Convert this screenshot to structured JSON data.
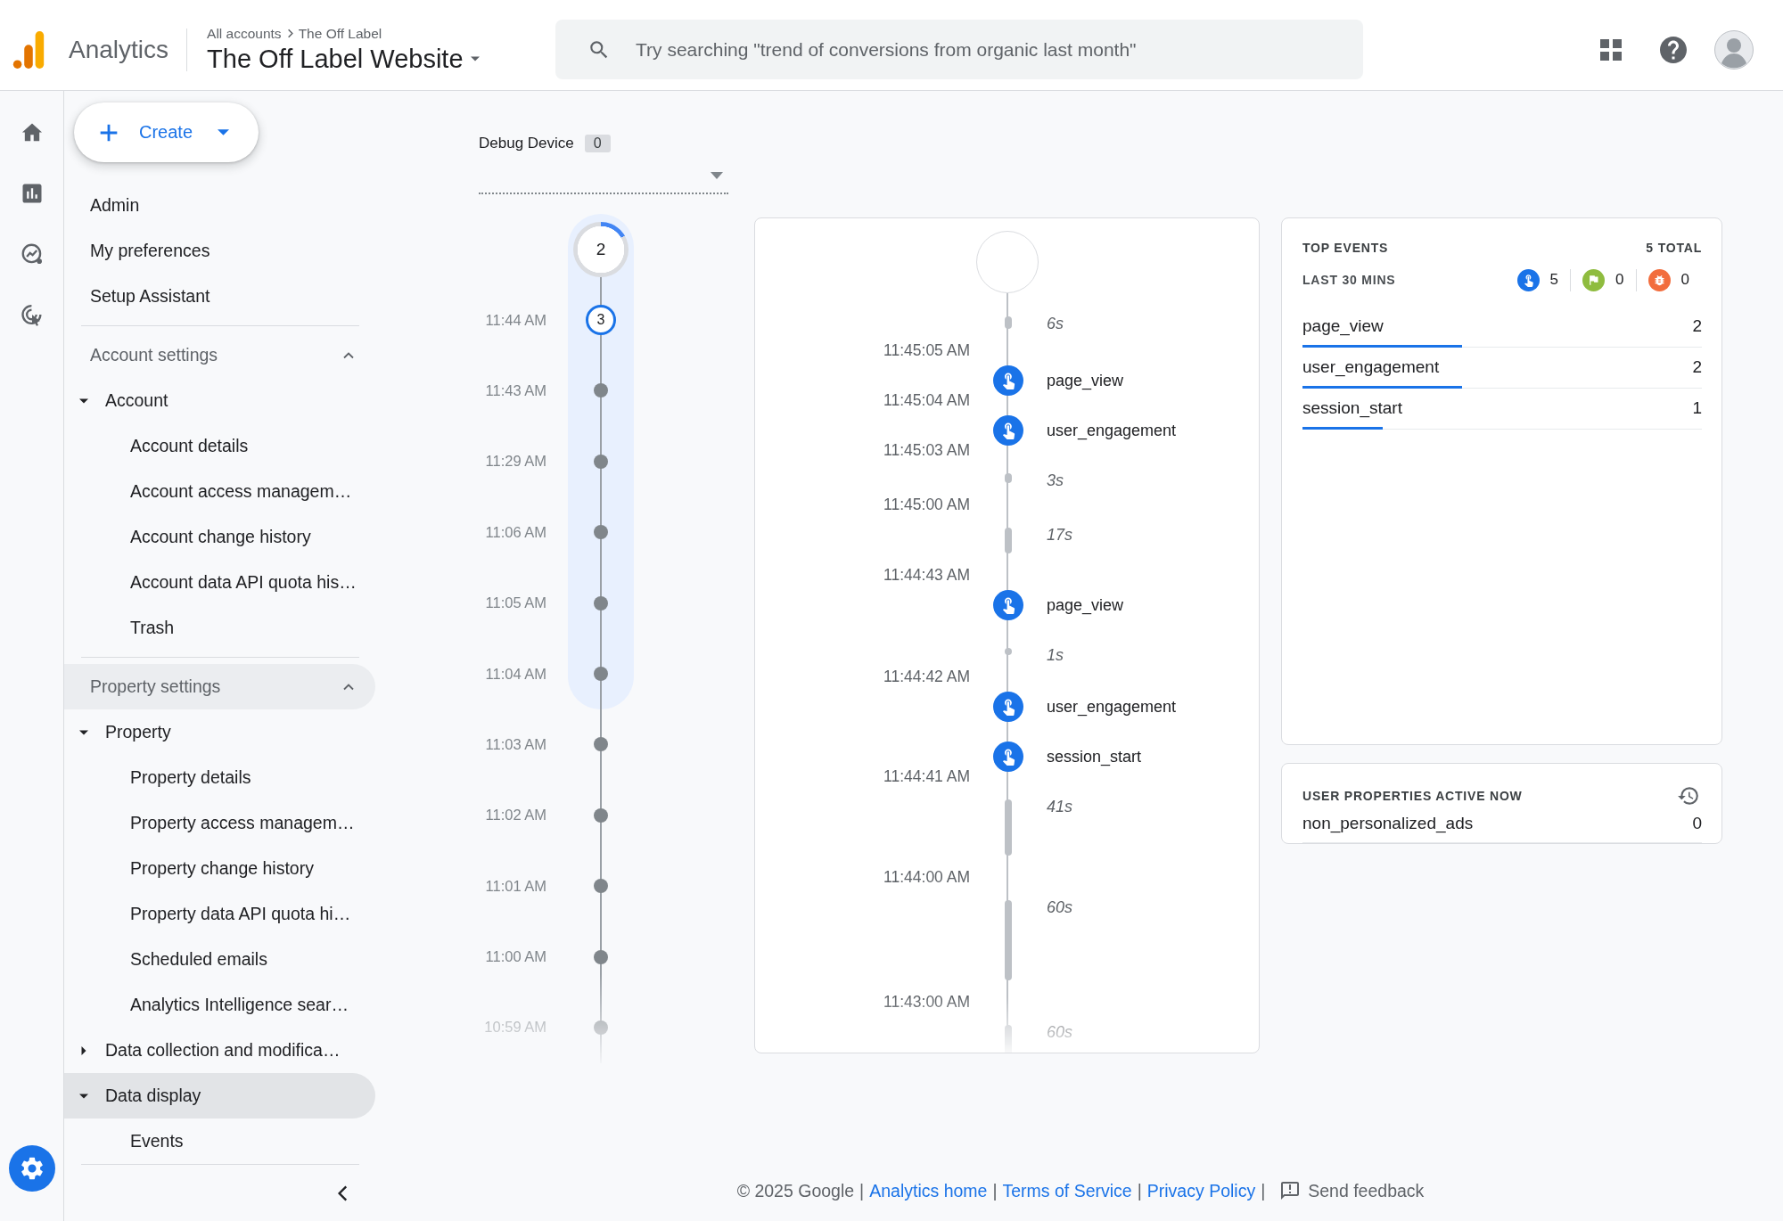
{
  "header": {
    "app_name": "Analytics",
    "breadcrumb": [
      "All accounts",
      "The Off Label"
    ],
    "property": "The Off Label Website",
    "search": {
      "placeholder": "Try searching \"trend of conversions from organic last month\""
    }
  },
  "rail": {
    "items": [
      {
        "kind": "home",
        "selected": false
      },
      {
        "kind": "reports",
        "selected": false
      },
      {
        "kind": "explore",
        "selected": false
      },
      {
        "kind": "advertising",
        "selected": false
      }
    ],
    "footer_items": [
      {
        "kind": "admin",
        "selected": true
      }
    ]
  },
  "nav": {
    "create": {
      "label": "Create"
    },
    "links": [
      {
        "label": "Admin",
        "selected": false
      },
      {
        "label": "My preferences",
        "selected": false
      },
      {
        "label": "Setup Assistant",
        "selected": false
      }
    ],
    "sections": [
      {
        "title": "Account settings",
        "expanded": true,
        "selected": false,
        "groups": [
          {
            "label": "Account",
            "expanded": true,
            "selected": false,
            "children": [
              {
                "label": "Account details",
                "selected": false
              },
              {
                "label": "Account access managem…",
                "selected": false
              },
              {
                "label": "Account change history",
                "selected": false
              },
              {
                "label": "Account data API quota his…",
                "selected": false
              },
              {
                "label": "Trash",
                "selected": false
              }
            ]
          }
        ]
      },
      {
        "title": "Property settings",
        "expanded": true,
        "selected": true,
        "groups": [
          {
            "label": "Property",
            "expanded": true,
            "selected": false,
            "children": [
              {
                "label": "Property details",
                "selected": false
              },
              {
                "label": "Property access managem…",
                "selected": false
              },
              {
                "label": "Property change history",
                "selected": false
              },
              {
                "label": "Property data API quota hi…",
                "selected": false
              },
              {
                "label": "Scheduled emails",
                "selected": false
              },
              {
                "label": "Analytics Intelligence sear…",
                "selected": false
              }
            ]
          },
          {
            "label": "Data collection and modifica…",
            "expanded": false,
            "selected": false
          },
          {
            "label": "Data display",
            "expanded": true,
            "selected": true,
            "children": [
              {
                "label": "Events",
                "selected": false
              }
            ]
          }
        ]
      }
    ]
  },
  "debug_device": {
    "label": "Debug Device",
    "count": "0"
  },
  "minutes": {
    "counter": {
      "count": "2"
    },
    "recent": [
      {
        "time": "11:44 AM",
        "count": "3",
        "selected": true
      },
      {
        "time": "11:43 AM",
        "selected": false
      },
      {
        "time": "11:29 AM",
        "selected": false
      },
      {
        "time": "11:06 AM",
        "selected": false
      },
      {
        "time": "11:05 AM",
        "selected": false
      },
      {
        "time": "11:04 AM",
        "selected": false
      }
    ],
    "earlier": [
      {
        "time": "11:03 AM",
        "selected": false
      },
      {
        "time": "11:02 AM",
        "selected": false
      },
      {
        "time": "11:01 AM",
        "selected": false
      },
      {
        "time": "11:00 AM",
        "selected": false
      },
      {
        "time": "10:59 AM",
        "selected": false
      }
    ]
  },
  "stream": [
    {
      "kind": "gap",
      "duration": "6s"
    },
    {
      "kind": "event",
      "time": "11:45:05 AM",
      "name": "page_view"
    },
    {
      "kind": "event",
      "time": "11:45:04 AM",
      "name": "user_engagement"
    },
    {
      "kind": "gap",
      "time": "11:45:03 AM",
      "duration": "3s"
    },
    {
      "kind": "gap",
      "time": "11:45:00 AM",
      "duration": "17s"
    },
    {
      "kind": "event",
      "time": "11:44:43 AM",
      "name": "page_view"
    },
    {
      "kind": "gap",
      "duration": "1s"
    },
    {
      "kind": "event",
      "time": "11:44:42 AM",
      "name": "user_engagement"
    },
    {
      "kind": "event",
      "name": "session_start"
    },
    {
      "kind": "gap",
      "time": "11:44:41 AM",
      "duration": "41s"
    },
    {
      "kind": "gap",
      "time": "11:44:00 AM",
      "duration": "60s"
    },
    {
      "kind": "gap",
      "time": "11:43:00 AM",
      "duration": "60s"
    }
  ],
  "top_events": {
    "title": "TOP EVENTS",
    "total": "5 TOTAL",
    "period": "LAST 30 MINS",
    "counts": [
      {
        "kind": "event",
        "count": "5"
      },
      {
        "kind": "conversion",
        "count": "0"
      },
      {
        "kind": "error",
        "count": "0"
      }
    ],
    "rows": [
      {
        "name": "page_view",
        "count": "2",
        "level": 0.4
      },
      {
        "name": "user_engagement",
        "count": "2",
        "level": 0.4
      },
      {
        "name": "session_start",
        "count": "1",
        "level": 0.2
      }
    ]
  },
  "user_properties": {
    "title": "USER PROPERTIES ACTIVE NOW",
    "rows": [
      {
        "name": "non_personalized_ads",
        "value": "0"
      }
    ]
  },
  "footer": {
    "items": [
      {
        "kind": "text",
        "text": "© 2025 Google"
      },
      {
        "kind": "separator",
        "text": "|"
      },
      {
        "kind": "link",
        "text": "Analytics home"
      },
      {
        "kind": "separator",
        "text": "|"
      },
      {
        "kind": "link",
        "text": "Terms of Service"
      },
      {
        "kind": "separator",
        "text": "|"
      },
      {
        "kind": "link",
        "text": "Privacy Policy"
      },
      {
        "kind": "separator",
        "text": "|"
      },
      {
        "kind": "feedback",
        "text": "Send feedback"
      }
    ]
  }
}
